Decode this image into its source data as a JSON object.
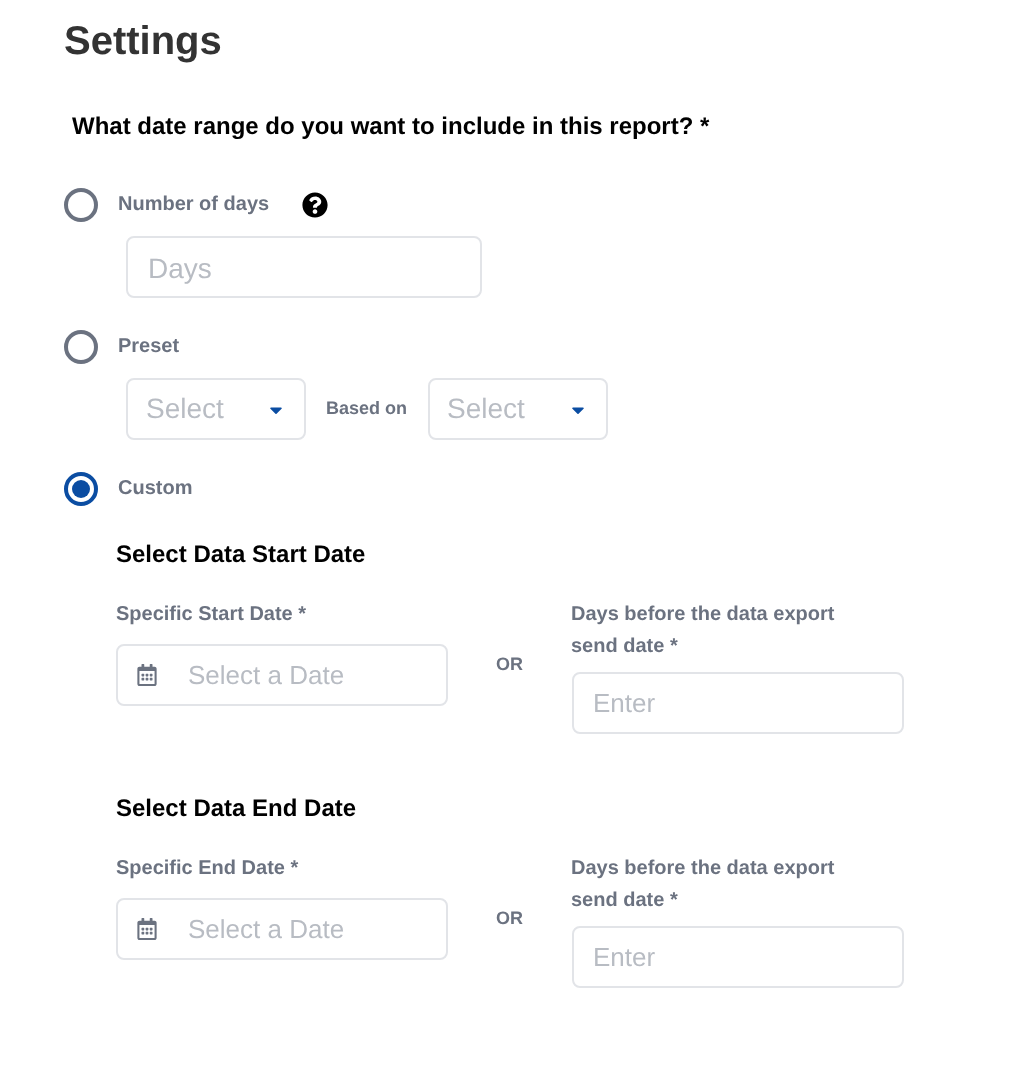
{
  "title": "Settings",
  "question": "What date range do you want to include in this report? *",
  "options": [
    {
      "kind": "days",
      "label": "Number of days",
      "selected": false,
      "placeholder": "Days"
    },
    {
      "kind": "preset",
      "label": "Preset",
      "selected": false,
      "select_1": "Select",
      "based_on": "Based on",
      "select_2": "Select"
    },
    {
      "kind": "custom",
      "label": "Custom",
      "selected": true,
      "sections": [
        {
          "heading": "Select Data Start Date",
          "date_label": "Specific Start Date *",
          "date_placeholder": "Select a Date",
          "or": "OR",
          "days_label": "Days before the data export send date *",
          "days_placeholder": "Enter"
        },
        {
          "heading": "Select Data End Date",
          "date_label": "Specific End Date *",
          "date_placeholder": "Select a Date",
          "or": "OR",
          "days_label": "Days before the data export send date *",
          "days_placeholder": "Enter"
        }
      ]
    }
  ]
}
